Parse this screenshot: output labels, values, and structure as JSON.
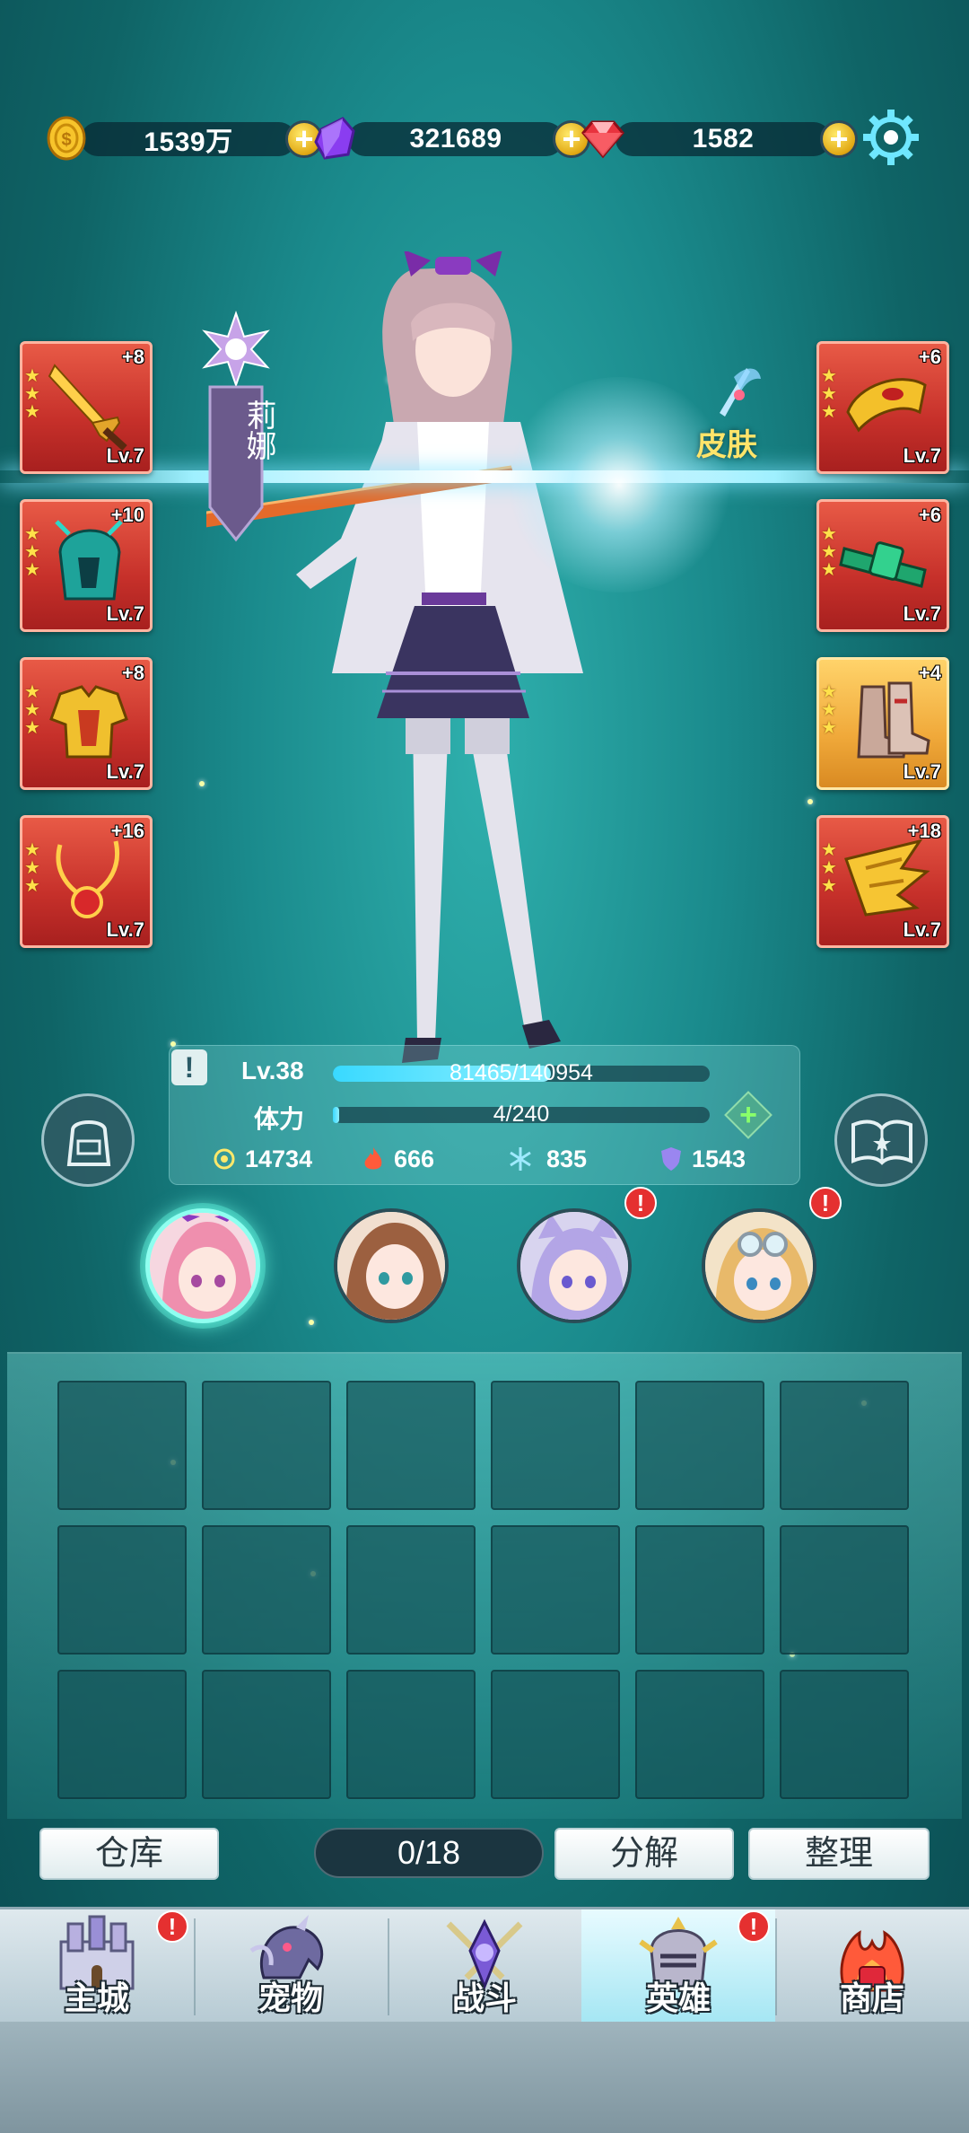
{
  "currencies": {
    "gold": {
      "value": "1539万",
      "icon": "gold-coin-icon"
    },
    "crystal": {
      "value": "321689",
      "icon": "purple-crystal-icon"
    },
    "ruby": {
      "value": "1582",
      "icon": "red-gem-icon"
    }
  },
  "settings_icon": "gear-icon",
  "hero_name": "莉娜",
  "skin_label": "皮肤",
  "equipment_left": [
    {
      "plus": "+8",
      "level": "Lv.7",
      "item": "dagger"
    },
    {
      "plus": "+10",
      "level": "Lv.7",
      "item": "helmet"
    },
    {
      "plus": "+8",
      "level": "Lv.7",
      "item": "armor"
    },
    {
      "plus": "+16",
      "level": "Lv.7",
      "item": "necklace"
    }
  ],
  "equipment_right": [
    {
      "plus": "+6",
      "level": "Lv.7",
      "item": "bracer"
    },
    {
      "plus": "+6",
      "level": "Lv.7",
      "item": "belt"
    },
    {
      "plus": "+4",
      "level": "Lv.7",
      "item": "boots"
    },
    {
      "plus": "+18",
      "level": "Lv.7",
      "item": "wing"
    }
  ],
  "stats": {
    "level_label": "Lv.38",
    "exp_text": "81465/140954",
    "exp_fraction": 0.578,
    "stamina_label": "体力",
    "stamina_text": "4/240",
    "stamina_fraction": 0.017,
    "power": "14734",
    "attack": "666",
    "frost": "835",
    "defense": "1543"
  },
  "heroes": [
    {
      "name": "hero-pink-hair",
      "active": true,
      "alert": false
    },
    {
      "name": "hero-brown-hair",
      "active": false,
      "alert": false
    },
    {
      "name": "hero-cat-ears",
      "active": false,
      "alert": true
    },
    {
      "name": "hero-goggles",
      "active": false,
      "alert": true
    }
  ],
  "inventory": {
    "warehouse_label": "仓库",
    "count": "0/18",
    "decompose_label": "分解",
    "sort_label": "整理"
  },
  "nav": [
    {
      "label": "主城",
      "icon": "castle-icon",
      "alert": true
    },
    {
      "label": "宠物",
      "icon": "dragon-icon",
      "alert": false
    },
    {
      "label": "战斗",
      "icon": "crossed-swords-icon",
      "alert": false
    },
    {
      "label": "英雄",
      "icon": "knight-helmet-icon",
      "alert": true
    },
    {
      "label": "商店",
      "icon": "shop-icon",
      "alert": false
    }
  ]
}
